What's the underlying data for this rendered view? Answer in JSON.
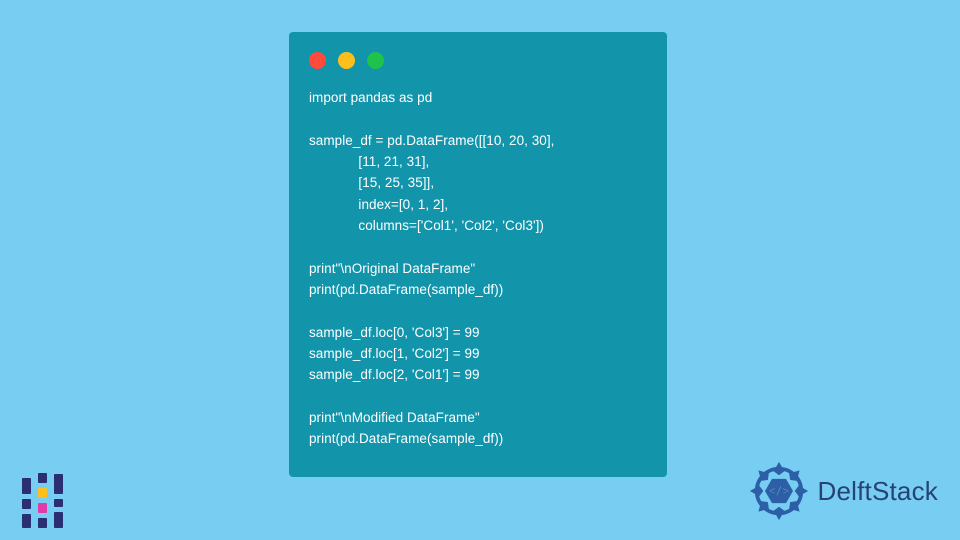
{
  "window": {
    "dots": [
      "red",
      "yellow",
      "green"
    ]
  },
  "code": {
    "lines": [
      "import pandas as pd",
      "",
      "sample_df = pd.DataFrame([[10, 20, 30],",
      "             [11, 21, 31],",
      "             [15, 25, 35]],",
      "             index=[0, 1, 2],",
      "             columns=['Col1', 'Col2', 'Col3'])",
      "",
      "print\"\\nOriginal DataFrame\"",
      "print(pd.DataFrame(sample_df))",
      "",
      "sample_df.loc[0, 'Col3'] = 99",
      "sample_df.loc[1, 'Col2'] = 99",
      "sample_df.loc[2, 'Col1'] = 99",
      "",
      "print\"\\nModified DataFrame\"",
      "print(pd.DataFrame(sample_df))"
    ]
  },
  "brand": {
    "name": "DelftStack"
  },
  "colors": {
    "page_bg": "#78cdf2",
    "card_bg": "#1294ab",
    "code_text": "#ffffff",
    "dot_red": "#ff4a3d",
    "dot_yellow": "#ffbf1a",
    "dot_green": "#1fc24a",
    "brand_text": "#264374"
  }
}
